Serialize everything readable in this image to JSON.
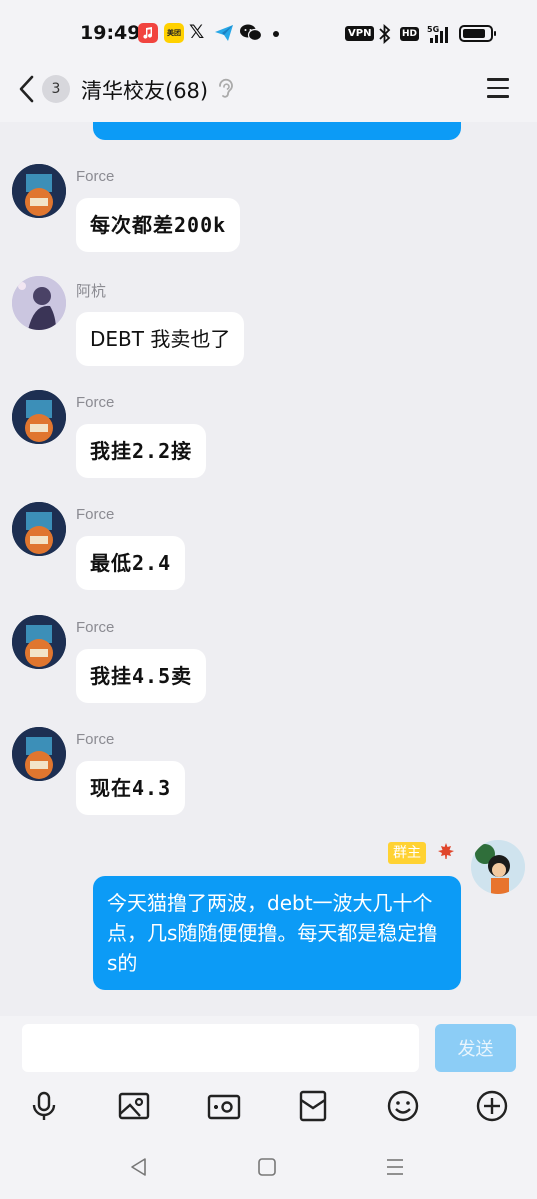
{
  "status_bar": {
    "time": "19:49",
    "meituan_label": "美团",
    "x_label": "𝕏",
    "vpn_label": "VPN",
    "hd_label": "HD",
    "network_label": "5G",
    "icons": [
      "music-app-icon",
      "meituan-app-icon",
      "x-app-icon",
      "plane-app-icon",
      "wechat-app-icon",
      "bluetooth-icon",
      "signal-icon",
      "battery-icon"
    ]
  },
  "header": {
    "unread_count": "3",
    "title": "清华校友(68)",
    "icons": [
      "back-arrow-icon",
      "ear-icon",
      "menu-icon"
    ]
  },
  "messages": [
    {
      "sender": "Force",
      "text": "每次都差200k"
    },
    {
      "sender": "阿杭",
      "text": "DEBT 我卖也了"
    },
    {
      "sender": "Force",
      "text": "我挂2.2接"
    },
    {
      "sender": "Force",
      "text": "最低2.4"
    },
    {
      "sender": "Force",
      "text": "我挂4.5卖"
    },
    {
      "sender": "Force",
      "text": "现在4.3"
    }
  ],
  "self_message": {
    "badge": "群主",
    "text": "今天猫撸了两波，debt一波大几十个点，几s随随便便撸。每天都是稳定撸s的"
  },
  "composer": {
    "input_value": "",
    "send_label": "发送"
  },
  "toolbar": {
    "icons": [
      "microphone-icon",
      "image-icon",
      "camera-icon",
      "red-packet-icon",
      "emoji-icon",
      "plus-icon"
    ]
  },
  "nav": {
    "icons": [
      "nav-back-icon",
      "nav-home-icon",
      "nav-menu-icon"
    ]
  },
  "colors": {
    "self_bubble": "#0c9bf6",
    "background": "#eeeef2",
    "owner_badge": "#ffd233",
    "send_button": "#8ccdf6"
  }
}
